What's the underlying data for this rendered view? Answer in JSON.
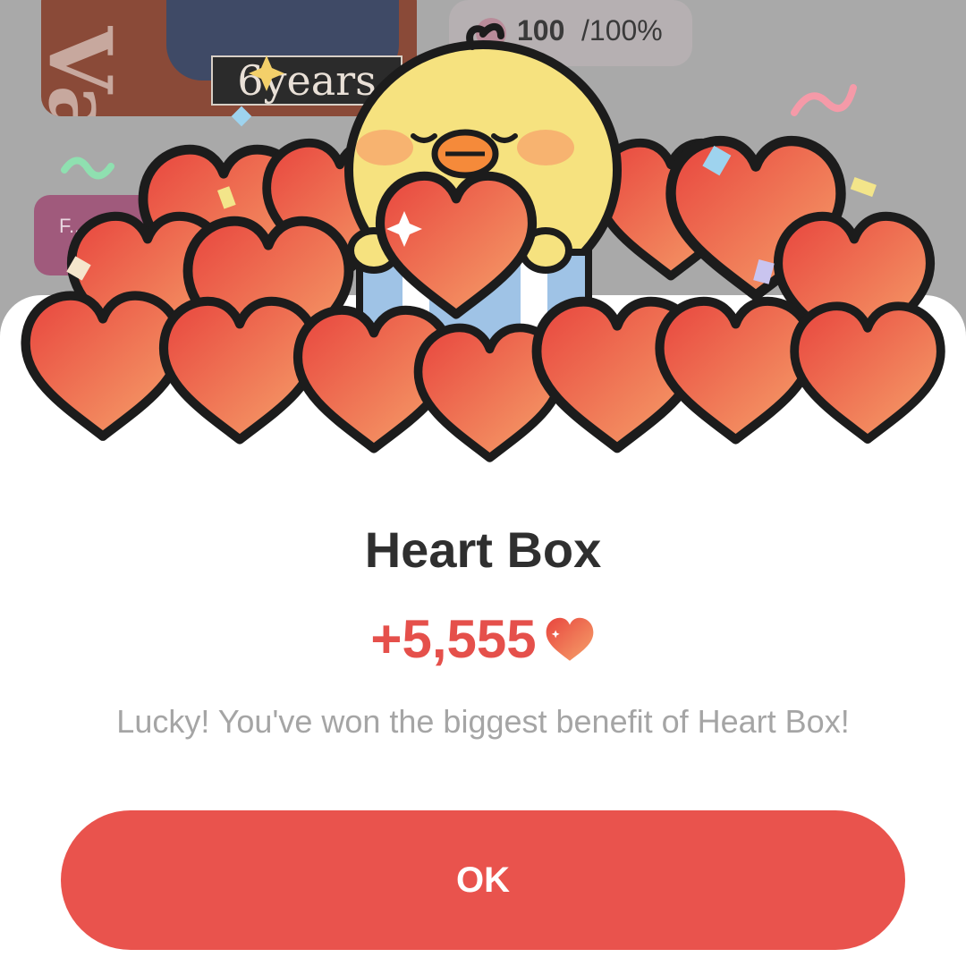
{
  "background": {
    "thumbnail_badge": "6years",
    "tag_label": "F...",
    "progress": {
      "value": "100",
      "max_label": "/100%"
    }
  },
  "dialog": {
    "title": "Heart Box",
    "reward_amount": "+5,555",
    "reward_icon": "heart-icon",
    "message": "Lucky! You've won the biggest benefit of Heart Box!",
    "ok_label": "OK"
  },
  "colors": {
    "accent": "#e9534d",
    "reward_text": "#e5504b",
    "message_text": "#a5a5a5"
  }
}
